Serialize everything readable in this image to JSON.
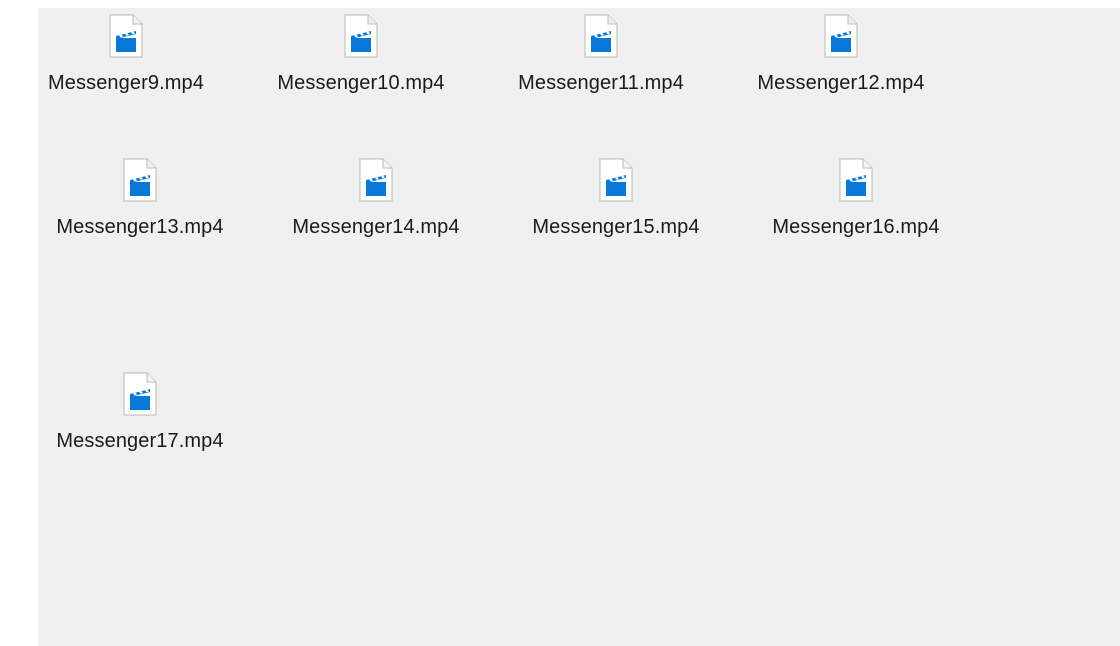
{
  "explorer": {
    "items": [
      {
        "name": "Messenger9.mp4",
        "icon": "video-file-icon"
      },
      {
        "name": "Messenger10.mp4",
        "icon": "video-file-icon"
      },
      {
        "name": "Messenger11.mp4",
        "icon": "video-file-icon"
      },
      {
        "name": "Messenger12.mp4",
        "icon": "video-file-icon"
      },
      {
        "name": "Messenger13.mp4",
        "icon": "video-file-icon"
      },
      {
        "name": "Messenger14.mp4",
        "icon": "video-file-icon"
      },
      {
        "name": "Messenger15.mp4",
        "icon": "video-file-icon"
      },
      {
        "name": "Messenger16.mp4",
        "icon": "video-file-icon"
      },
      {
        "name": "Messenger17.mp4",
        "icon": "video-file-icon"
      }
    ]
  },
  "colors": {
    "background": "#f0f0f0",
    "icon_blue": "#0a78d7",
    "icon_stripe": "#2f8fe3"
  }
}
